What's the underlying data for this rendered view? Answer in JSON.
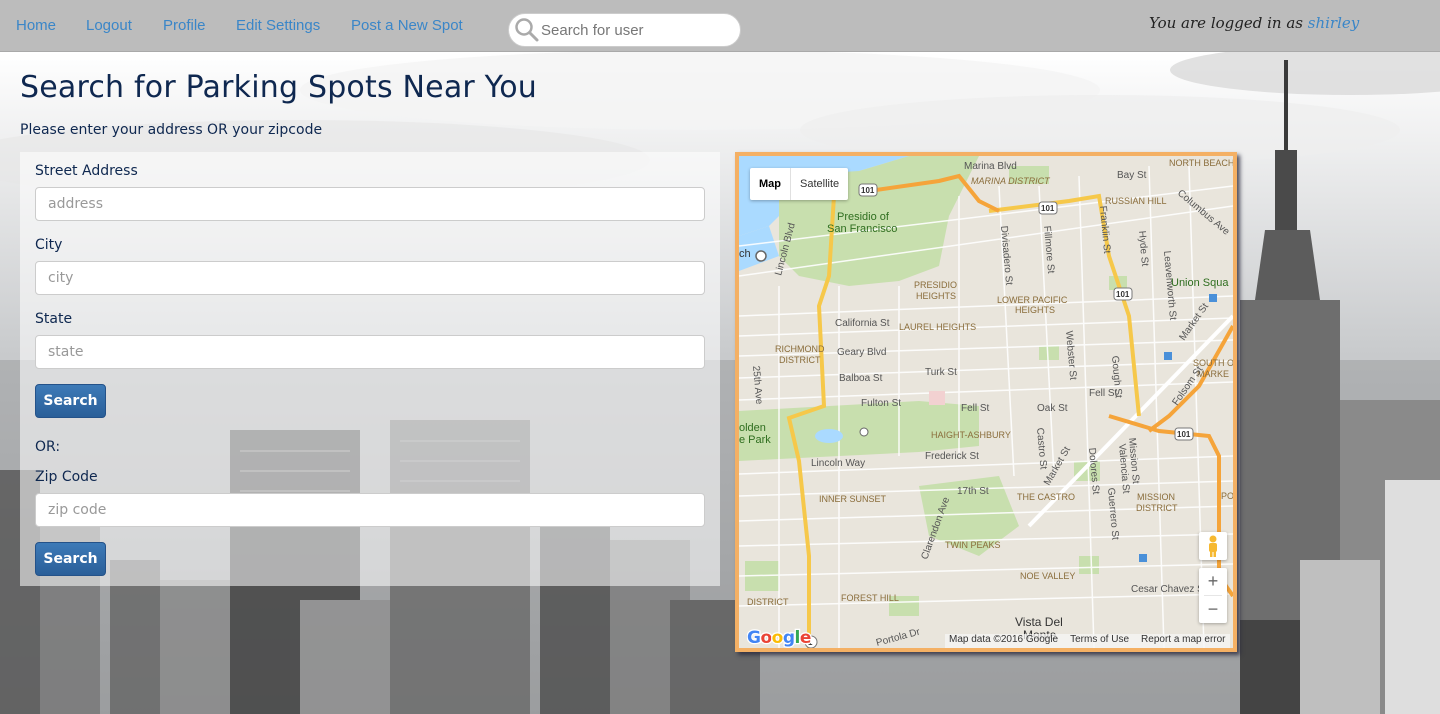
{
  "nav": {
    "links": [
      "Home",
      "Logout",
      "Profile",
      "Edit Settings",
      "Post a New Spot"
    ],
    "search_placeholder": "Search for user",
    "logged_in_prefix": "You are logged in as",
    "username": "shirley"
  },
  "page": {
    "title": "Search for Parking Spots Near You",
    "subtitle": "Please enter your address OR your zipcode"
  },
  "form": {
    "street_label": "Street Address",
    "street_placeholder": "address",
    "city_label": "City",
    "city_placeholder": "city",
    "state_label": "State",
    "state_placeholder": "state",
    "search_button": "Search",
    "or_label": "OR:",
    "zip_label": "Zip Code",
    "zip_placeholder": "zip code",
    "zip_search_button": "Search"
  },
  "map": {
    "type_map": "Map",
    "type_satellite": "Satellite",
    "zoom_in": "+",
    "zoom_out": "−",
    "logo": "Google",
    "data_credit": "Map data ©2016 Google",
    "terms": "Terms of Use",
    "report": "Report a map error",
    "labels": {
      "marina_blvd": "Marina Blvd",
      "north_beach": "NORTH BEACH",
      "marina_district": "MARINA DISTRICT",
      "bay_st": "Bay St",
      "russian_hill": "RUSSIAN HILL",
      "columbus_ave": "Columbus Ave",
      "presidio_1": "Presidio of",
      "presidio_2": "San Francisco",
      "lincoln_blvd": "Lincoln Blvd",
      "divisadero": "Divisadero St",
      "fillmore": "Fillmore St",
      "franklin": "Franklin St",
      "hyde": "Hyde St",
      "leavenworth": "Leavenworth St",
      "union_square": "Union Squa",
      "presidio_heights_1": "PRESIDIO",
      "presidio_heights_2": "HEIGHTS",
      "lower_pacific_1": "LOWER PACIFIC",
      "lower_pacific_2": "HEIGHTS",
      "california_st": "California St",
      "laurel_heights": "LAUREL HEIGHTS",
      "richmond_1": "RICHMOND",
      "richmond_2": "DISTRICT",
      "geary_blvd": "Geary Blvd",
      "webster": "Webster St",
      "gough": "Gough St",
      "market_st": "Market St",
      "south_of_1": "SOUTH O",
      "south_of_2": "MARKE",
      "ave_25": "25th Ave",
      "balboa_st": "Balboa St",
      "turk_st": "Turk St",
      "fell_st_1": "Fell St",
      "fell_st_2": "Fell St",
      "oak_st": "Oak St",
      "fulton_st": "Fulton St",
      "folsom_st": "Folsom St",
      "golden_1": "olden",
      "golden_2": "e Park",
      "haight_ashbury": "HAIGHT-ASHBURY",
      "castro_st": "Castro St",
      "mission_st": "Mission St",
      "valencia": "Valencia St",
      "lincoln_way": "Lincoln Way",
      "frederick_st": "Frederick St",
      "market_st_2": "Market St",
      "dolores": "Dolores St",
      "guerrero": "Guerrero St",
      "inner_sunset": "INNER SUNSET",
      "st_17": "17th St",
      "the_castro": "THE CASTRO",
      "mission_district_1": "MISSION",
      "mission_district_2": "DISTRICT",
      "clarendon": "Clarendon Ave",
      "twin_peaks": "TWIN PEAKS",
      "noe_valley": "NOE VALLEY",
      "district": "DISTRICT",
      "forest_hill": "FOREST HILL",
      "cesar_chavez": "Cesar Chavez St",
      "vista_1": "Vista Del",
      "vista_2": "Monte",
      "portola": "Portola Dr",
      "ch": "ch",
      "pot": "POT",
      "hwy_101": "101",
      "hwy_1": "1"
    }
  }
}
